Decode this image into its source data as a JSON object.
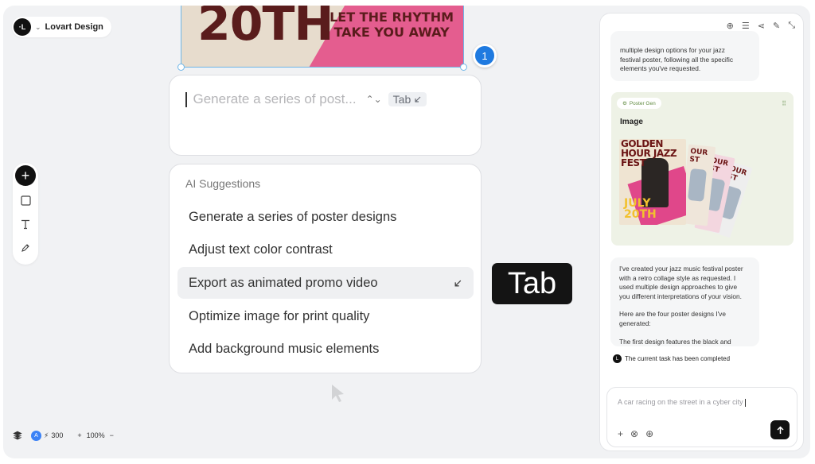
{
  "brand": {
    "name": "Lovart Design",
    "logo_text": "·L"
  },
  "poster": {
    "big_text": "20TH",
    "tag_line1": "LET THE RHYTHM",
    "tag_line2": "TAKE YOU AWAY"
  },
  "canvas": {
    "badge_number": "1"
  },
  "prompt": {
    "placeholder": "Generate a series of post...",
    "tab_chip": "Tab"
  },
  "suggestions": {
    "heading": "AI Suggestions",
    "items": [
      {
        "label": "Generate a series of poster designs"
      },
      {
        "label": "Adjust text color contrast"
      },
      {
        "label": "Export as animated promo video"
      },
      {
        "label": "Optimize image for print quality"
      },
      {
        "label": "Add background music elements"
      }
    ]
  },
  "tab_key": "Tab",
  "bottom_bar": {
    "avatar": "A",
    "credits": "300",
    "zoom": "100%"
  },
  "chat": {
    "top_message": "multiple design options for your jazz festival poster, following all the specific elements you've requested.",
    "card": {
      "tool_name": "Poster Gen",
      "title": "Image",
      "poster1_heading": "GOLDEN HOUR JAZZ FEST",
      "poster1_footer": "JULY 20TH",
      "mini_heading": "OUR ST"
    },
    "reply": {
      "p1_lines": [
        "I've created your jazz music festival poster",
        "with a retro collage style as requested. I",
        "used multiple design approaches to give",
        "you different interpretations of your vision."
      ],
      "p2_lines": [
        "Here are the four poster designs I've",
        "generated:"
      ],
      "p3_lines": [
        "The first design features the black and"
      ]
    },
    "status": "The current task has been completed",
    "input_placeholder": "A car racing on the street in a cyber city"
  },
  "colors": {
    "accent_blue": "#1f7ae0",
    "poster_pink": "#e45d8f",
    "poster_brown": "#5a1c1c",
    "card_green": "#eef2e6"
  }
}
